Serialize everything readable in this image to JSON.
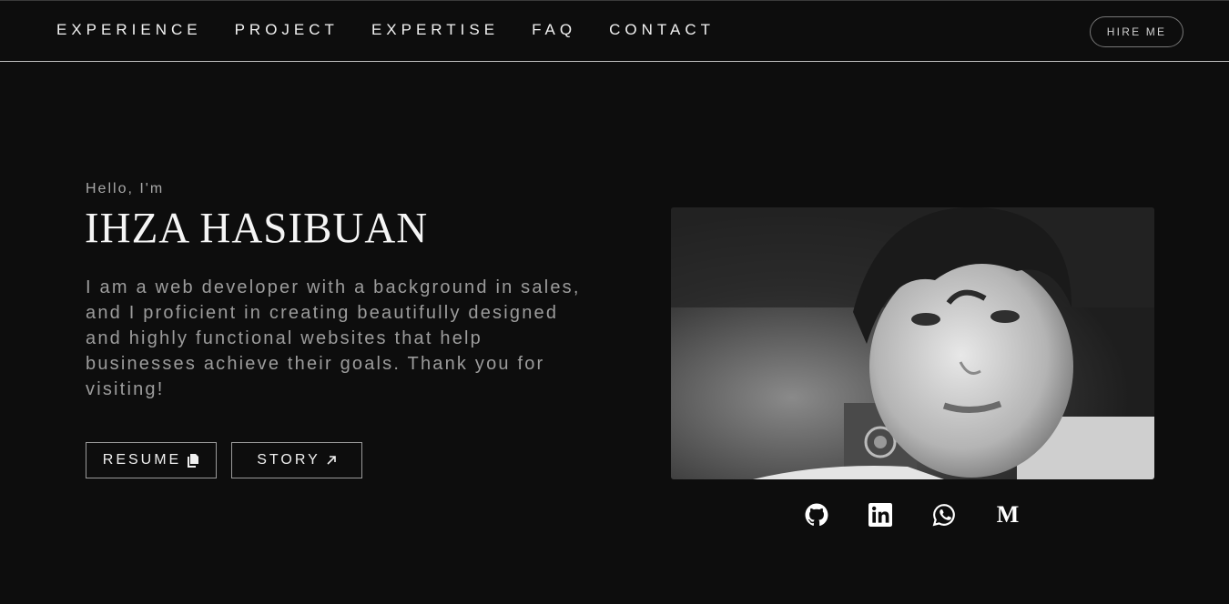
{
  "nav": {
    "items": [
      "EXPERIENCE",
      "PROJECT",
      "EXPERTISE",
      "FAQ",
      "CONTACT"
    ],
    "hire_label": "HIRE ME"
  },
  "hero": {
    "greeting": "Hello, I'm",
    "name": "IHZA HASIBUAN",
    "bio": "I am a web developer with a background in sales, and I proficient in creating beautifully designed and highly functional websites that help businesses achieve their goals. Thank you for visiting!",
    "resume_label": "RESUME",
    "story_label": "STORY"
  },
  "socials": {
    "icons": [
      "github-icon",
      "linkedin-icon",
      "whatsapp-icon",
      "medium-icon"
    ],
    "medium_glyph": "M"
  },
  "colors": {
    "background": "#0d0d0d",
    "text": "#f2f2f2",
    "muted": "#9c9c9c",
    "border": "#9a9a9a"
  }
}
